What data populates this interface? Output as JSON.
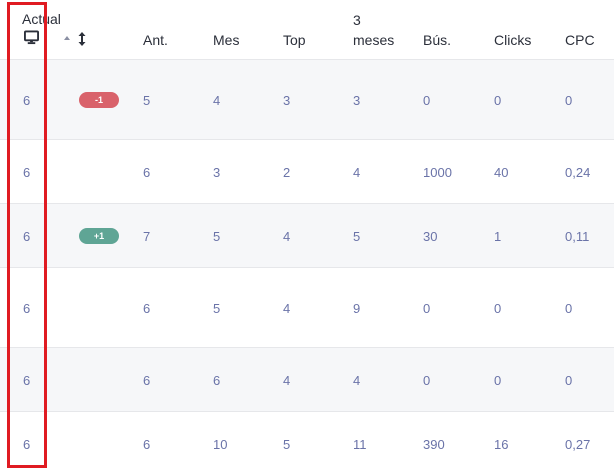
{
  "header": {
    "actual": "Actual",
    "ant": "Ant.",
    "mes": "Mes",
    "top": "Top",
    "tres_meses_line1": "3",
    "tres_meses_line2": "meses",
    "bus": "Bús.",
    "clicks": "Clicks",
    "cpc": "CPC",
    "device_icon": "desktop-monitor-icon",
    "sort_icon": "sort-updown-icon"
  },
  "rows": [
    {
      "actual": "6",
      "change": "-1",
      "ant": "5",
      "mes": "4",
      "top": "3",
      "tres_meses": "3",
      "bus": "0",
      "clicks": "0",
      "cpc": "0"
    },
    {
      "actual": "6",
      "change": "",
      "ant": "6",
      "mes": "3",
      "top": "2",
      "tres_meses": "4",
      "bus": "1000",
      "clicks": "40",
      "cpc": "0,24"
    },
    {
      "actual": "6",
      "change": "+1",
      "ant": "7",
      "mes": "5",
      "top": "4",
      "tres_meses": "5",
      "bus": "30",
      "clicks": "1",
      "cpc": "0,11"
    },
    {
      "actual": "6",
      "change": "",
      "ant": "6",
      "mes": "5",
      "top": "4",
      "tres_meses": "9",
      "bus": "0",
      "clicks": "0",
      "cpc": "0"
    },
    {
      "actual": "6",
      "change": "",
      "ant": "6",
      "mes": "6",
      "top": "4",
      "tres_meses": "4",
      "bus": "0",
      "clicks": "0",
      "cpc": "0"
    },
    {
      "actual": "6",
      "change": "",
      "ant": "6",
      "mes": "10",
      "top": "5",
      "tres_meses": "11",
      "bus": "390",
      "clicks": "16",
      "cpc": "0,27"
    }
  ],
  "colors": {
    "negative_badge": "#d9626b",
    "positive_badge": "#5fa595",
    "value_text": "#6a73a8",
    "highlight": "#e01b22"
  }
}
